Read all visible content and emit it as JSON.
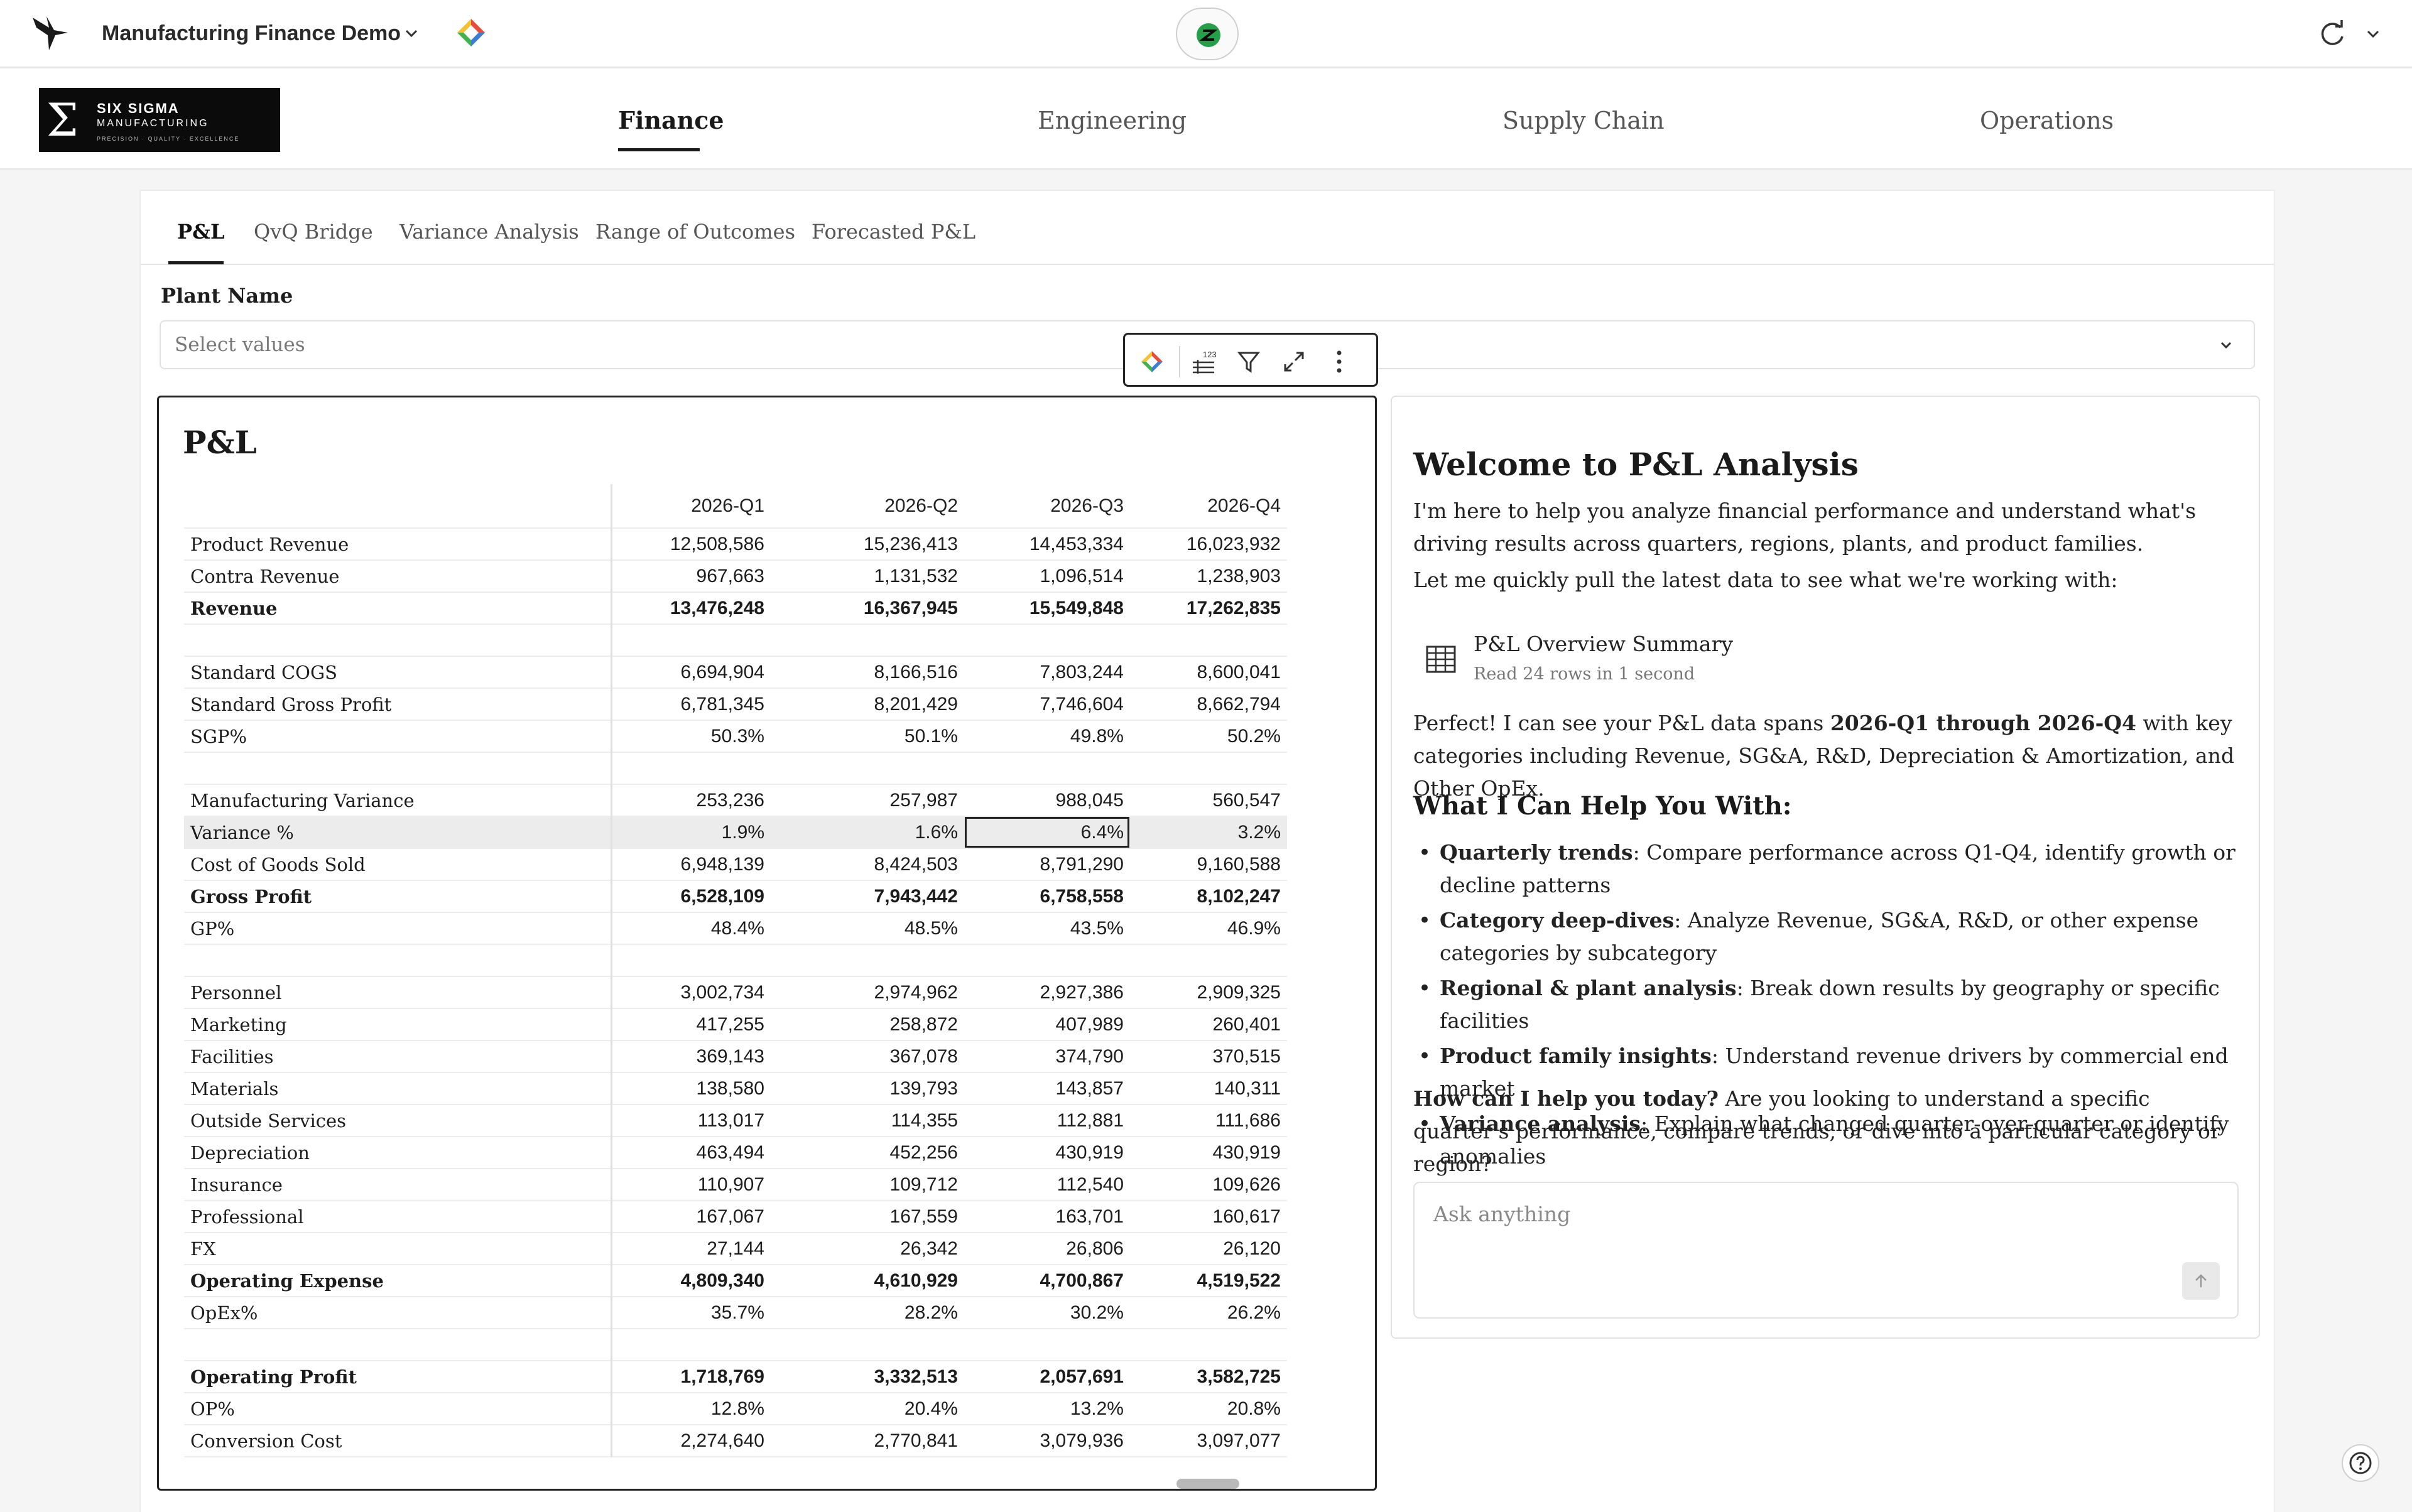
{
  "app": {
    "title": "Manufacturing Finance Demo"
  },
  "brand": {
    "symbol": "Σ",
    "line1": "SIX SIGMA",
    "line2": "MANUFACTURING",
    "line3": "PRECISION · QUALITY · EXCELLENCE"
  },
  "nav": {
    "tabs": [
      "Finance",
      "Engineering",
      "Supply Chain",
      "Operations"
    ],
    "active": "Finance"
  },
  "subtabs": {
    "items": [
      "P&L",
      "QvQ Bridge",
      "Variance Analysis",
      "Range of Outcomes",
      "Forecasted P&L"
    ],
    "active": "P&L"
  },
  "filter": {
    "label": "Plant Name",
    "placeholder": "Select values"
  },
  "pl": {
    "title": "P&L",
    "columns": [
      "2026-Q1",
      "2026-Q2",
      "2026-Q3",
      "2026-Q4"
    ],
    "rows": [
      {
        "label": "Product Revenue",
        "values": [
          "12,508,586",
          "15,236,413",
          "14,453,334",
          "16,023,932"
        ]
      },
      {
        "label": "Contra Revenue",
        "values": [
          "967,663",
          "1,131,532",
          "1,096,514",
          "1,238,903"
        ]
      },
      {
        "label": "Revenue",
        "values": [
          "13,476,248",
          "16,367,945",
          "15,549,848",
          "17,262,835"
        ],
        "bold": true
      },
      {
        "label": "",
        "values": [
          "",
          "",
          "",
          ""
        ]
      },
      {
        "label": "Standard COGS",
        "values": [
          "6,694,904",
          "8,166,516",
          "7,803,244",
          "8,600,041"
        ]
      },
      {
        "label": "Standard Gross Profit",
        "values": [
          "6,781,345",
          "8,201,429",
          "7,746,604",
          "8,662,794"
        ]
      },
      {
        "label": "SGP%",
        "values": [
          "50.3%",
          "50.1%",
          "49.8%",
          "50.2%"
        ]
      },
      {
        "label": "",
        "values": [
          "",
          "",
          "",
          ""
        ]
      },
      {
        "label": "Manufacturing Variance",
        "values": [
          "253,236",
          "257,987",
          "988,045",
          "560,547"
        ]
      },
      {
        "label": "Variance %",
        "values": [
          "1.9%",
          "1.6%",
          "6.4%",
          "3.2%"
        ],
        "highlight": true
      },
      {
        "label": "Cost of Goods Sold",
        "values": [
          "6,948,139",
          "8,424,503",
          "8,791,290",
          "9,160,588"
        ]
      },
      {
        "label": "Gross Profit",
        "values": [
          "6,528,109",
          "7,943,442",
          "6,758,558",
          "8,102,247"
        ],
        "bold": true
      },
      {
        "label": "GP%",
        "values": [
          "48.4%",
          "48.5%",
          "43.5%",
          "46.9%"
        ]
      },
      {
        "label": "",
        "values": [
          "",
          "",
          "",
          ""
        ]
      },
      {
        "label": "Personnel",
        "values": [
          "3,002,734",
          "2,974,962",
          "2,927,386",
          "2,909,325"
        ]
      },
      {
        "label": "Marketing",
        "values": [
          "417,255",
          "258,872",
          "407,989",
          "260,401"
        ]
      },
      {
        "label": "Facilities",
        "values": [
          "369,143",
          "367,078",
          "374,790",
          "370,515"
        ]
      },
      {
        "label": "Materials",
        "values": [
          "138,580",
          "139,793",
          "143,857",
          "140,311"
        ]
      },
      {
        "label": "Outside Services",
        "values": [
          "113,017",
          "114,355",
          "112,881",
          "111,686"
        ]
      },
      {
        "label": "Depreciation",
        "values": [
          "463,494",
          "452,256",
          "430,919",
          "430,919"
        ]
      },
      {
        "label": "Insurance",
        "values": [
          "110,907",
          "109,712",
          "112,540",
          "109,626"
        ]
      },
      {
        "label": "Professional",
        "values": [
          "167,067",
          "167,559",
          "163,701",
          "160,617"
        ]
      },
      {
        "label": "FX",
        "values": [
          "27,144",
          "26,342",
          "26,806",
          "26,120"
        ]
      },
      {
        "label": "Operating Expense",
        "values": [
          "4,809,340",
          "4,610,929",
          "4,700,867",
          "4,519,522"
        ],
        "bold": true
      },
      {
        "label": "OpEx%",
        "values": [
          "35.7%",
          "28.2%",
          "30.2%",
          "26.2%"
        ]
      },
      {
        "label": "",
        "values": [
          "",
          "",
          "",
          ""
        ]
      },
      {
        "label": "Operating Profit",
        "values": [
          "1,718,769",
          "3,332,513",
          "2,057,691",
          "3,582,725"
        ],
        "bold": true
      },
      {
        "label": "OP%",
        "values": [
          "12.8%",
          "20.4%",
          "13.2%",
          "20.8%"
        ]
      },
      {
        "label": "Conversion Cost",
        "values": [
          "2,274,640",
          "2,770,841",
          "3,079,936",
          "3,097,077"
        ]
      }
    ]
  },
  "chat": {
    "heading": "Welcome to P&L Analysis",
    "intro": "I'm here to help you analyze financial performance and understand what's driving results across quarters, regions, plants, and product families.",
    "lead": "Let me quickly pull the latest data to see what we're working with:",
    "tool": {
      "title": "P&L Overview Summary",
      "subtitle": "Read 24 rows in 1 second"
    },
    "summary_prefix": "Perfect! I can see your P&L data spans ",
    "summary_bold": "2026-Q1 through 2026-Q4",
    "summary_suffix": " with key categories including Revenue, SG&A, R&D, Depreciation & Amortization, and Other OpEx.",
    "help_heading": "What I Can Help You With:",
    "help_items": [
      {
        "title": "Quarterly trends",
        "text": ": Compare performance across Q1-Q4, identify growth or decline patterns"
      },
      {
        "title": "Category deep-dives",
        "text": ": Analyze Revenue, SG&A, R&D, or other expense categories by subcategory"
      },
      {
        "title": "Regional & plant analysis",
        "text": ": Break down results by geography or specific facilities"
      },
      {
        "title": "Product family insights",
        "text": ": Understand revenue drivers by commercial end market"
      },
      {
        "title": "Variance analysis",
        "text": ": Explain what changed quarter-over-quarter or identify anomalies"
      }
    ],
    "question_bold": "How can I help you today?",
    "question_text": " Are you looking to understand a specific quarter's performance, compare trends, or dive into a particular category or region?",
    "input_placeholder": "Ask anything"
  },
  "icons": {
    "app_logo": "bird-logo-icon",
    "chevron": "chevron-down-icon",
    "gem": "gem-icon",
    "badge": "ai-badge-icon",
    "refresh": "refresh-icon",
    "toolbar": [
      "gem-icon",
      "number-format-icon",
      "filter-icon",
      "expand-icon",
      "more-vertical-icon"
    ],
    "table": "table-icon",
    "send": "arrow-up-icon",
    "help": "help-icon"
  }
}
